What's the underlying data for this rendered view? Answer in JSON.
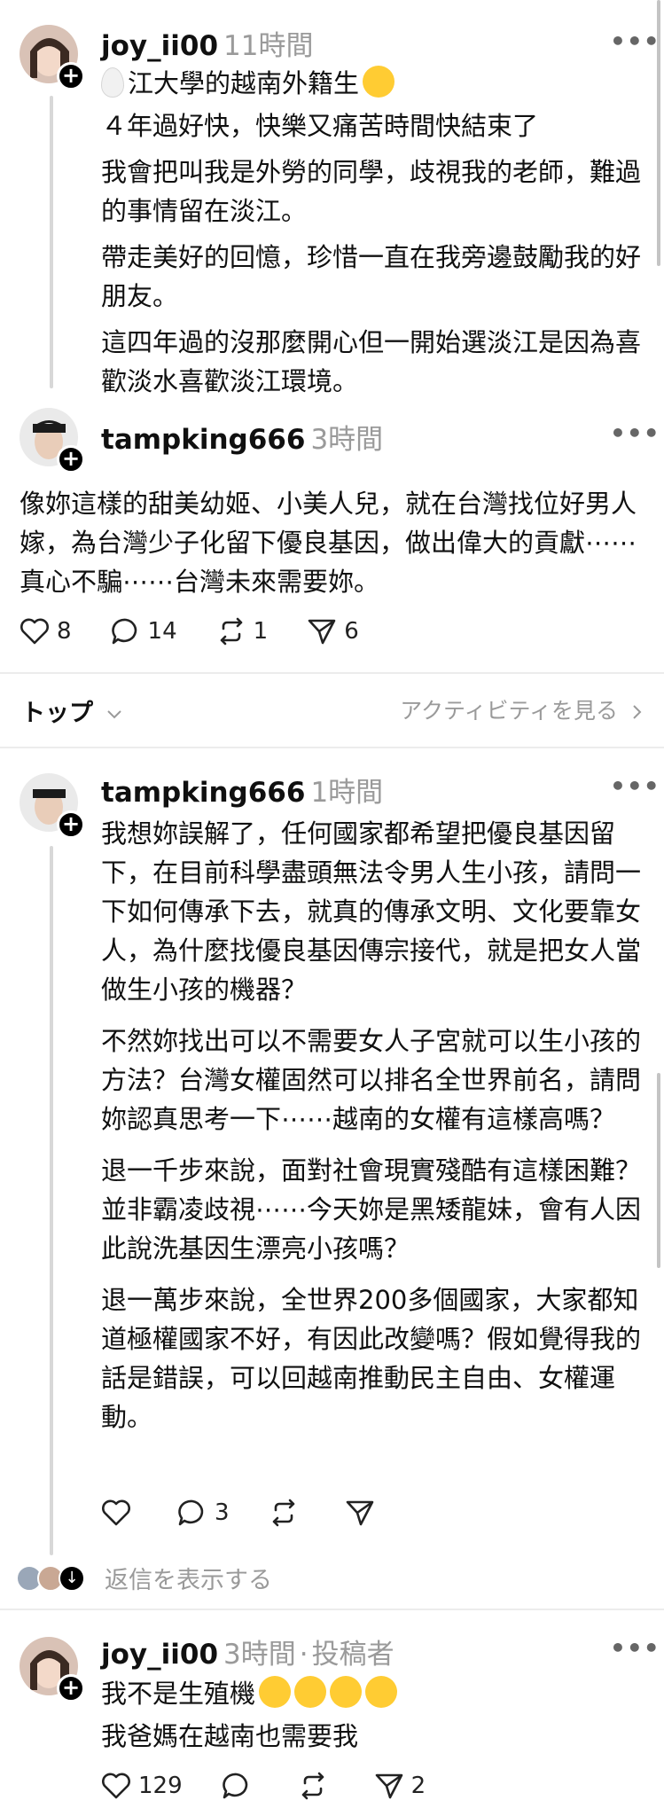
{
  "posts": [
    {
      "username": "joy_ii00",
      "time": "11時間",
      "lines": [
        "江大學的越南外籍生",
        "４年過好快，快樂又痛苦時間快結束了",
        "我會把叫我是外勞的同學，歧視我的老師，難過的事情留在淡江。",
        "帶走美好的回憶，珍惜一直在我旁邊鼓勵我的好朋友。",
        "這四年過的沒那麼開心但一開始選淡江是因為喜歡淡水喜歡淡江環境。"
      ],
      "emoji": "smiling-face-emoji",
      "leading_icon": "egg-emoji"
    },
    {
      "username": "tampking666",
      "time": "3時間",
      "text": "像妳這樣的甜美幼姬、小美人兒，就在台灣找位好男人嫁，為台灣少子化留下優良基因，做出偉大的貢獻⋯⋯真心不騙⋯⋯台灣未來需要妳。",
      "likes": "8",
      "comments": "14",
      "reposts": "1",
      "shares": "6"
    }
  ],
  "tabbar": {
    "top_label": "トップ",
    "activity_label": "アクティビティを見る"
  },
  "reply1": {
    "username": "tampking666",
    "time": "1時間",
    "paragraphs": [
      "我想妳誤解了，任何國家都希望把優良基因留下，在目前科學盡頭無法令男人生小孩，請問一下如何傳承下去，就真的傳承文明、文化要靠女人，為什麼找優良基因傳宗接代，就是把女人當做生小孩的機器？",
      "不然妳找出可以不需要女人子宮就可以生小孩的方法？台灣女權固然可以排名全世界前名，請問妳認真思考一下⋯⋯越南的女權有這樣高嗎？",
      "退一千步來說，面對社會現實殘酷有這樣困難？並非霸凌歧視⋯⋯今天妳是黑矮龍妹，會有人因此說洗基因生漂亮小孩嗎？",
      "退一萬步來說，全世界200多個國家，大家都知道極權國家不好，有因此改變嗎？假如覺得我的話是錯誤，可以回越南推動民主自由、女權運動。"
    ],
    "comments": "3",
    "show_replies": "返信を表示する"
  },
  "reply2": {
    "username": "joy_ii00",
    "time": "3時間",
    "author_tag": "投稿者",
    "line1": "我不是生殖機",
    "line2": "我爸媽在越南也需要我",
    "likes": "129",
    "shares": "2"
  },
  "colors": {
    "text": "#101010",
    "muted": "#9a9a9a",
    "divider": "#ececec",
    "emoji": "#ffcc33"
  }
}
